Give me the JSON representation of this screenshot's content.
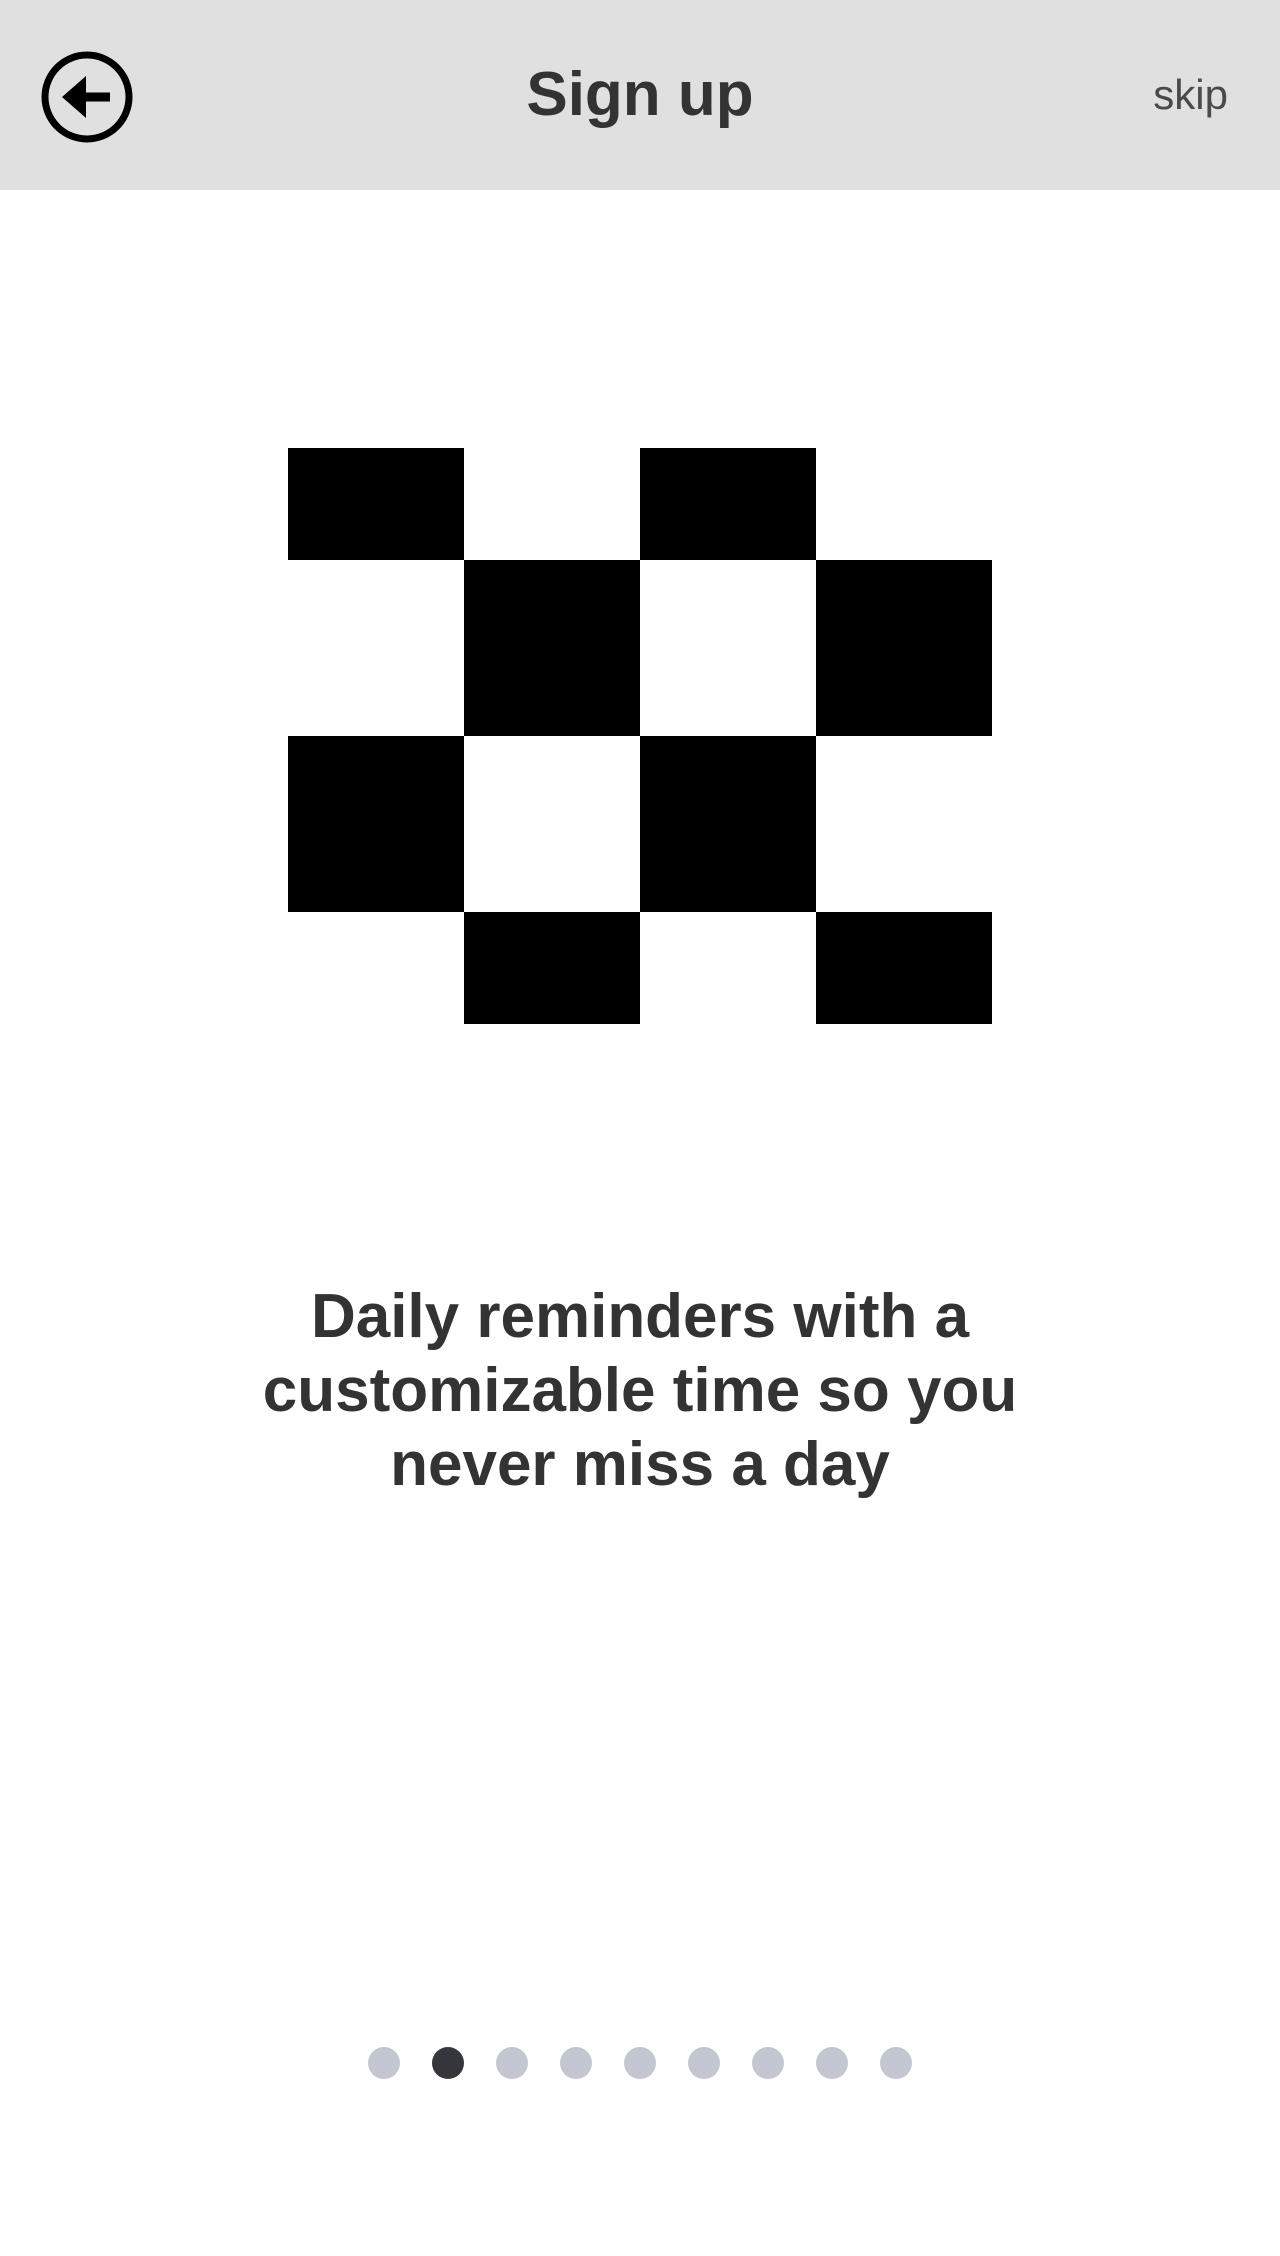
{
  "header": {
    "title": "Sign up",
    "skip_label": "skip",
    "back_icon": "arrow-left-circle-icon",
    "background_color": "#e0e0e0"
  },
  "illustration": {
    "icon": "checkerboard-pattern-icon",
    "color": "#000000"
  },
  "main": {
    "description": "Daily reminders with a customizable time so you never miss a day"
  },
  "pager": {
    "total": 9,
    "active_index": 1,
    "active_color": "#35363b",
    "inactive_color": "#c2c6d1"
  }
}
